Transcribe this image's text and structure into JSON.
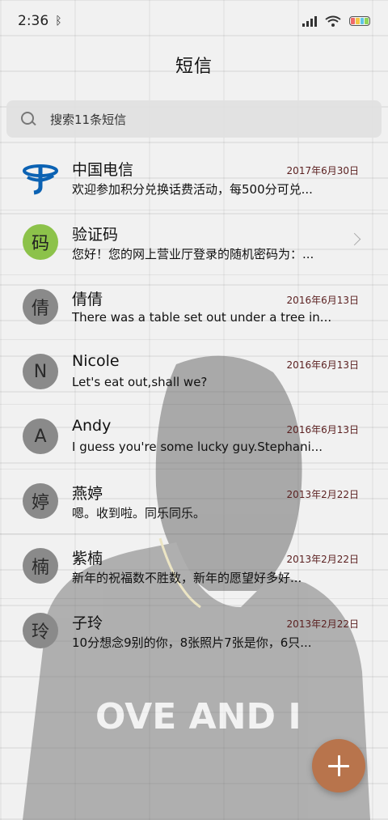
{
  "status": {
    "time": "2:36",
    "bluetooth": "ᛒ"
  },
  "header": {
    "title": "短信"
  },
  "search": {
    "placeholder": "搜索11条短信"
  },
  "conversations": [
    {
      "name": "中国电信",
      "date": "2017年6月30日",
      "preview": "欢迎参加积分兑换话费活动，每500分可兑...",
      "avatar": "",
      "avatar_type": "telecom-logo"
    },
    {
      "name": "验证码",
      "date": "",
      "preview": "您好！您的网上营业厅登录的随机密码为：...",
      "avatar": "码",
      "avatar_type": "green"
    },
    {
      "name": "倩倩",
      "date": "2016年6月13日",
      "preview": "There was a table set out under a tree in...",
      "avatar": "倩",
      "avatar_type": "gray"
    },
    {
      "name": "Nicole",
      "date": "2016年6月13日",
      "preview": "Let's eat out,shall we?",
      "avatar": "N",
      "avatar_type": "gray"
    },
    {
      "name": "Andy",
      "date": "2016年6月13日",
      "preview": "I guess you're some lucky guy.Stephani...",
      "avatar": "A",
      "avatar_type": "gray"
    },
    {
      "name": "燕婷",
      "date": "2013年2月22日",
      "preview": "嗯。收到啦。同乐同乐。",
      "avatar": "婷",
      "avatar_type": "gray"
    },
    {
      "name": "紫楠",
      "date": "2013年2月22日",
      "preview": "新年的祝福数不胜数，新年的愿望好多好...",
      "avatar": "楠",
      "avatar_type": "gray"
    },
    {
      "name": "子玲",
      "date": "2013年2月22日",
      "preview": "10分想念9别的你，8张照片7张是你，6只...",
      "avatar": "玲",
      "avatar_type": "gray"
    }
  ],
  "background_art": {
    "shirt_text": "OVE AND I"
  },
  "colors": {
    "fab": "#b8744c",
    "green_avatar": "#8cc24a",
    "date_text": "#5a1f1f",
    "telecom_blue": "#0b62b3"
  },
  "icons": {
    "search": "search-icon",
    "fab": "plus-icon",
    "chevron": "chevron-right-icon"
  }
}
